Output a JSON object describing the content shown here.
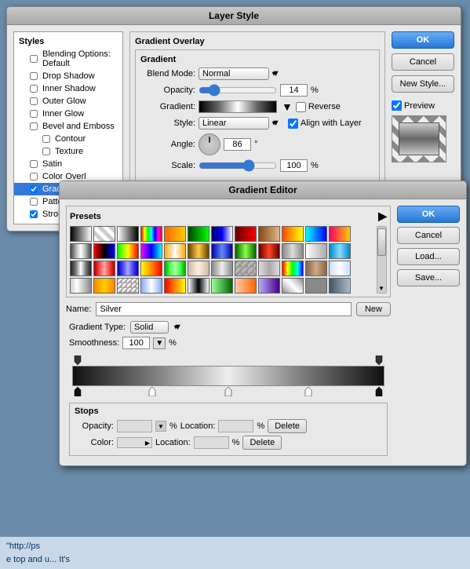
{
  "background": {
    "text1": "\"http://ps",
    "text2": "e top and u... It's"
  },
  "layerStyleDialog": {
    "title": "Layer Style",
    "sidebar": {
      "sectionLabel": "Styles",
      "items": [
        {
          "label": "Blending Options: Default",
          "checked": false,
          "selected": false
        },
        {
          "label": "Drop Shadow",
          "checked": false,
          "selected": false
        },
        {
          "label": "Inner Shadow",
          "checked": false,
          "selected": false
        },
        {
          "label": "Outer Glow",
          "checked": false,
          "selected": false
        },
        {
          "label": "Inner Glow",
          "checked": false,
          "selected": false
        },
        {
          "label": "Bevel and Emboss",
          "checked": false,
          "selected": false
        },
        {
          "label": "Contour",
          "checked": false,
          "selected": false
        },
        {
          "label": "Texture",
          "checked": false,
          "selected": false
        },
        {
          "label": "Satin",
          "checked": false,
          "selected": false
        },
        {
          "label": "Color Overl",
          "checked": false,
          "selected": false
        },
        {
          "label": "Gradient Ov",
          "checked": true,
          "selected": true
        },
        {
          "label": "Pattern Ove",
          "checked": false,
          "selected": false
        },
        {
          "label": "Stroke",
          "checked": true,
          "selected": false
        }
      ]
    },
    "gradientOverlay": {
      "sectionTitle": "Gradient Overlay",
      "subsectionTitle": "Gradient",
      "blendMode": {
        "label": "Blend Mode:",
        "value": "Normal"
      },
      "opacity": {
        "label": "Opacity:",
        "value": "14",
        "unit": "%"
      },
      "gradient": {
        "label": "Gradient:",
        "reverseLabel": "Reverse"
      },
      "style": {
        "label": "Style:",
        "value": "Linear",
        "alignLabel": "Align with Layer"
      },
      "angle": {
        "label": "Angle:",
        "value": "86",
        "unit": "°"
      },
      "scale": {
        "label": "Scale:",
        "value": "100",
        "unit": "%"
      }
    },
    "buttons": {
      "ok": "OK",
      "cancel": "Cancel",
      "newStyle": "New Style...",
      "preview": "Preview"
    }
  },
  "gradientEditorDialog": {
    "title": "Gradient Editor",
    "presetsLabel": "Presets",
    "nameLabel": "Name:",
    "nameValue": "Silver",
    "newButton": "New",
    "gradientTypeLabel": "Gradient Type:",
    "gradientTypeValue": "Solid",
    "smoothnessLabel": "Smoothness:",
    "smoothnessValue": "100",
    "smoothnessUnit": "%",
    "stopsSection": {
      "title": "Stops",
      "opacityLabel": "Opacity:",
      "opacityUnit": "%",
      "locationLabel": "Location:",
      "locationUnit": "%",
      "deleteOpacity": "Delete",
      "colorLabel": "Color:",
      "deleteColor": "Delete"
    },
    "buttons": {
      "ok": "OK",
      "cancel": "Cancel",
      "load": "Load...",
      "save": "Save..."
    }
  }
}
